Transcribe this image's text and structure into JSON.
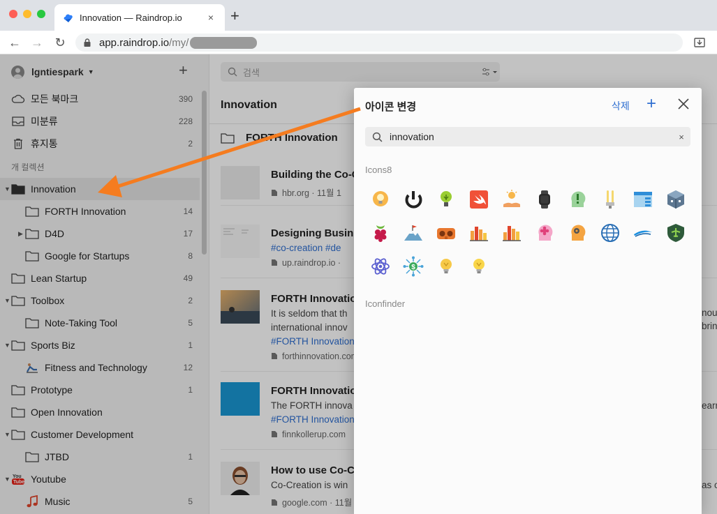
{
  "browser": {
    "tab_title": "Innovation — Raindrop.io",
    "new_tab_glyph": "+",
    "tab_close_glyph": "×",
    "url_host": "app.raindrop.io",
    "url_path": "/my/"
  },
  "sidebar": {
    "user_name": "lgntiespark",
    "add_glyph": "+",
    "system": [
      {
        "label": "모든 북마크",
        "count": "390",
        "icon": "cloud-icon"
      },
      {
        "label": "미분류",
        "count": "228",
        "icon": "inbox-icon"
      },
      {
        "label": "휴지통",
        "count": "2",
        "icon": "trash-icon"
      }
    ],
    "group_label": "개 컬렉션",
    "collections": [
      {
        "label": "Innovation",
        "count": "",
        "level": 0,
        "arrow": "▼",
        "icon": "folder-filled-icon",
        "active": true
      },
      {
        "label": "FORTH Innovation",
        "count": "14",
        "level": 1,
        "arrow": "",
        "icon": "folder-icon"
      },
      {
        "label": "D4D",
        "count": "17",
        "level": 1,
        "arrow": "▶",
        "icon": "folder-icon"
      },
      {
        "label": "Google for Startups",
        "count": "8",
        "level": 1,
        "arrow": "",
        "icon": "folder-icon"
      },
      {
        "label": "Lean Startup",
        "count": "49",
        "level": 0,
        "arrow": "",
        "icon": "folder-icon"
      },
      {
        "label": "Toolbox",
        "count": "2",
        "level": 0,
        "arrow": "▼",
        "icon": "folder-icon"
      },
      {
        "label": "Note-Taking Tool",
        "count": "5",
        "level": 1,
        "arrow": "",
        "icon": "folder-icon"
      },
      {
        "label": "Sports Biz",
        "count": "1",
        "level": 0,
        "arrow": "▼",
        "icon": "folder-icon"
      },
      {
        "label": "Fitness and Technology",
        "count": "12",
        "level": 1,
        "arrow": "",
        "icon": "fitness-icon"
      },
      {
        "label": "Prototype",
        "count": "1",
        "level": 0,
        "arrow": "",
        "icon": "folder-icon"
      },
      {
        "label": "Open Innovation",
        "count": "",
        "level": 0,
        "arrow": "",
        "icon": "folder-icon"
      },
      {
        "label": "Customer Development",
        "count": "",
        "level": 0,
        "arrow": "▼",
        "icon": "folder-icon"
      },
      {
        "label": "JTBD",
        "count": "1",
        "level": 1,
        "arrow": "",
        "icon": "folder-icon"
      },
      {
        "label": "Youtube",
        "count": "",
        "level": 0,
        "arrow": "▼",
        "icon": "youtube-icon"
      },
      {
        "label": "Music",
        "count": "5",
        "level": 1,
        "arrow": "",
        "icon": "music-note-icon"
      }
    ]
  },
  "main": {
    "search_placeholder": "검색",
    "title": "Innovation",
    "folder_row_label": "FORTH Innovation",
    "items": [
      {
        "title": "Building the Co-C",
        "lines": [],
        "meta": "hbr.org  ·  11월 1",
        "thumb": "blank"
      },
      {
        "title": "Designing Busine",
        "lines": [
          {
            "tag": "#co-creation  #de"
          }
        ],
        "meta": "up.raindrop.io  ·",
        "thumb": "doc"
      },
      {
        "title": "FORTH Innovation",
        "lines": [
          {
            "text": "It is seldom that th"
          },
          {
            "text": "international innov"
          },
          {
            "tag": "#FORTH Innovation"
          }
        ],
        "meta": "forthinnovation.com",
        "thumb": "sunset"
      },
      {
        "title": "FORTH Innovation",
        "lines": [
          {
            "text": "The FORTH innova"
          },
          {
            "tag": "#FORTH Innovation"
          }
        ],
        "meta": "finnkollerup.com",
        "thumb": "blue"
      },
      {
        "title": "How to use Co-C",
        "lines": [
          {
            "text": "Co-Creation is win"
          }
        ],
        "meta": "google.com  ·  11월",
        "thumb": "portrait"
      }
    ],
    "overflow_texts": [
      "nou",
      "brin",
      "earn",
      "as o"
    ]
  },
  "dialog": {
    "title": "아이콘 변경",
    "delete_label": "삭제",
    "add_glyph": "+",
    "search_value": "innovation",
    "clear_glyph": "×",
    "section_icons8": "Icons8",
    "section_iconfinder": "Iconfinder",
    "icons": [
      "bulb-head-icon",
      "power-loop-icon",
      "bulb-plant-icon",
      "swift-logo-icon",
      "hand-bulb-icon",
      "smartwatch-icon",
      "head-exclamation-icon",
      "tube-light-icon",
      "window-layout-icon",
      "virtualbox-icon",
      "raspberry-icon",
      "mountain-flag-icon",
      "vr-headset-icon",
      "bar-chart-icon",
      "bar-chart-2-icon",
      "flower-head-icon",
      "gear-head-icon",
      "globe-grid-icon",
      "bluray-icon",
      "shield-plane-icon",
      "atom-icon",
      "money-network-icon",
      "bulb-icon",
      "bulb-2-icon"
    ]
  },
  "colors": {
    "accent": "#2f6fd1",
    "annotation_arrow": "#f57c1f"
  }
}
